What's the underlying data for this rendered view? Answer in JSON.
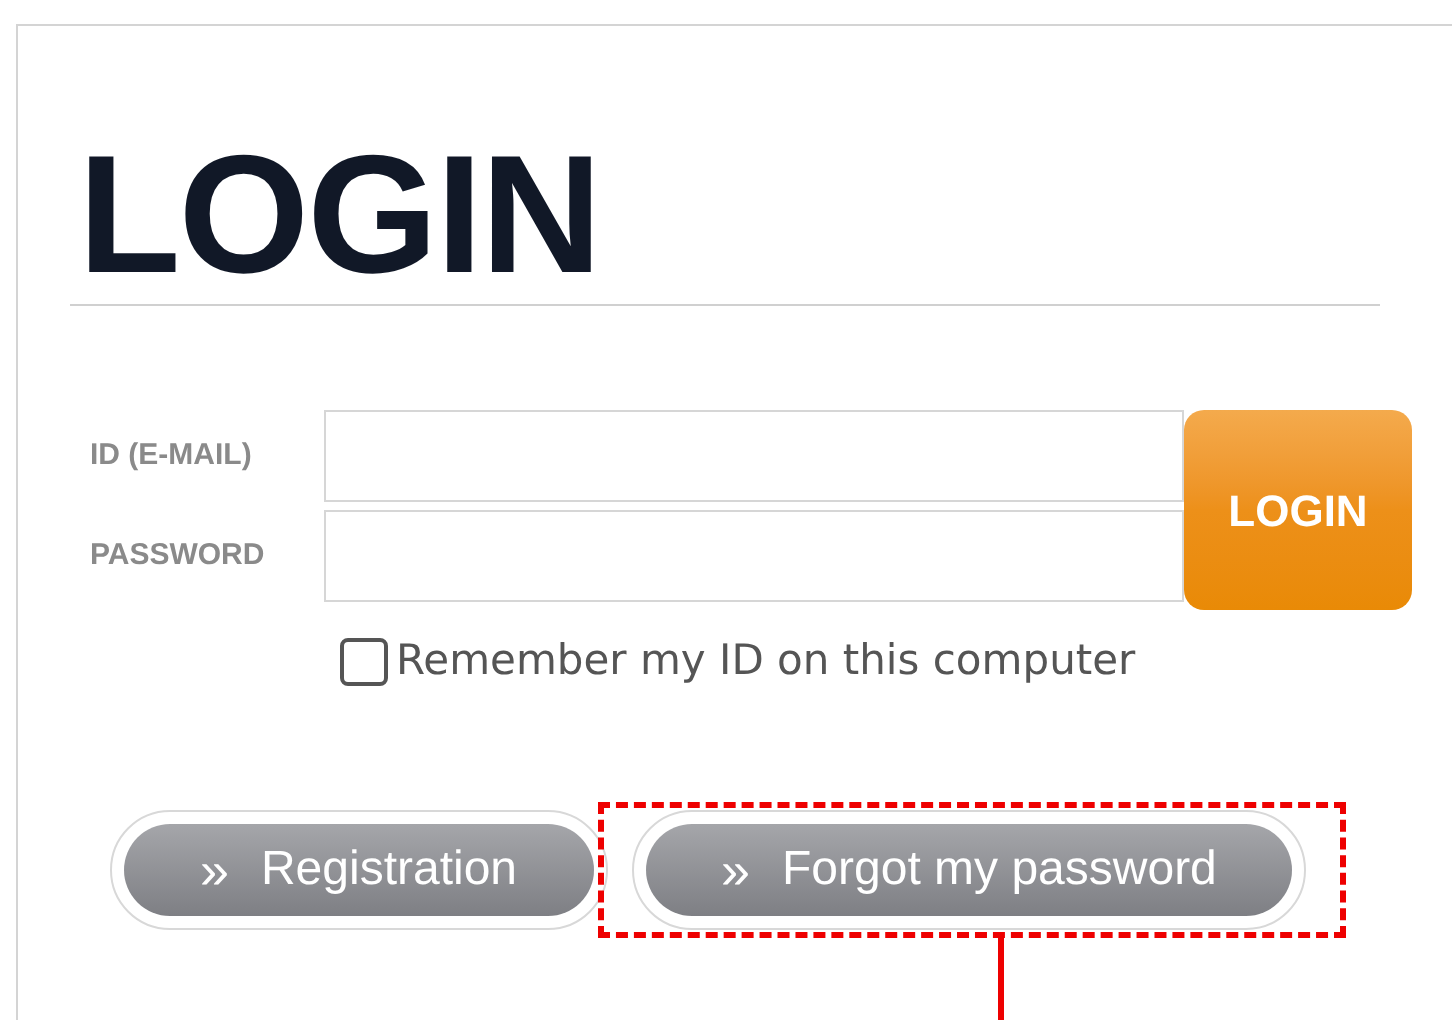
{
  "title": "LOGIN",
  "fields": [
    {
      "label": "ID (E-MAIL)"
    },
    {
      "label": "PASSWORD"
    }
  ],
  "login_button": "LOGIN",
  "remember": {
    "label": "Remember my ID on this computer",
    "checked": false
  },
  "links": [
    {
      "icon": "»",
      "label": "Registration",
      "highlighted": false
    },
    {
      "icon": "»",
      "label": "Forgot my password",
      "highlighted": true
    }
  ]
}
